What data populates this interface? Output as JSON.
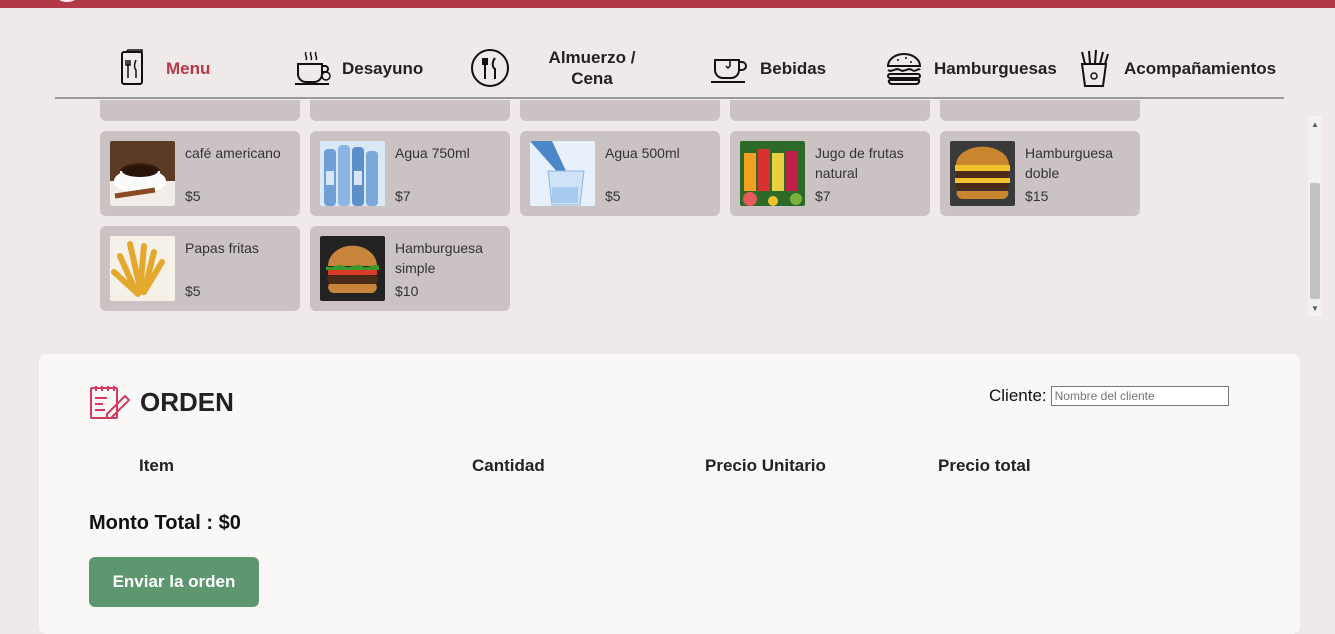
{
  "nav": {
    "items": [
      {
        "label": "Menu",
        "icon": "menu-book-icon",
        "active": true
      },
      {
        "label": "Desayuno",
        "icon": "breakfast-cup-icon"
      },
      {
        "label": "Almuerzo / Cena",
        "icon": "plate-utensils-icon"
      },
      {
        "label": "Bebidas",
        "icon": "coffee-cup-icon"
      },
      {
        "label": "Hamburguesas",
        "icon": "burger-icon"
      },
      {
        "label": "Acompañamientos",
        "icon": "fries-icon"
      }
    ]
  },
  "products": [
    {
      "name": "café americano",
      "price": "$5",
      "image": "coffee-photo"
    },
    {
      "name": "Agua 750ml",
      "price": "$7",
      "image": "water-bottles-photo"
    },
    {
      "name": "Agua 500ml",
      "price": "$5",
      "image": "water-glass-photo"
    },
    {
      "name": "Jugo de frutas natural",
      "price": "$7",
      "image": "juices-photo"
    },
    {
      "name": "Hamburguesa doble",
      "price": "$15",
      "image": "double-burger-photo"
    },
    {
      "name": "Papas fritas",
      "price": "$5",
      "image": "fries-photo"
    },
    {
      "name": "Hamburguesa simple",
      "price": "$10",
      "image": "burger-photo"
    }
  ],
  "order": {
    "title": "ORDEN",
    "client_label": "Cliente:",
    "client_placeholder": "Nombre del cliente",
    "columns": [
      "Item",
      "Cantidad",
      "Precio Unitario",
      "Precio total"
    ],
    "total_text": "Monto Total : $0",
    "send_label": "Enviar la orden"
  },
  "colors": {
    "brand": "#b23a48",
    "card": "#cbc2c4",
    "button": "#5e9670"
  }
}
